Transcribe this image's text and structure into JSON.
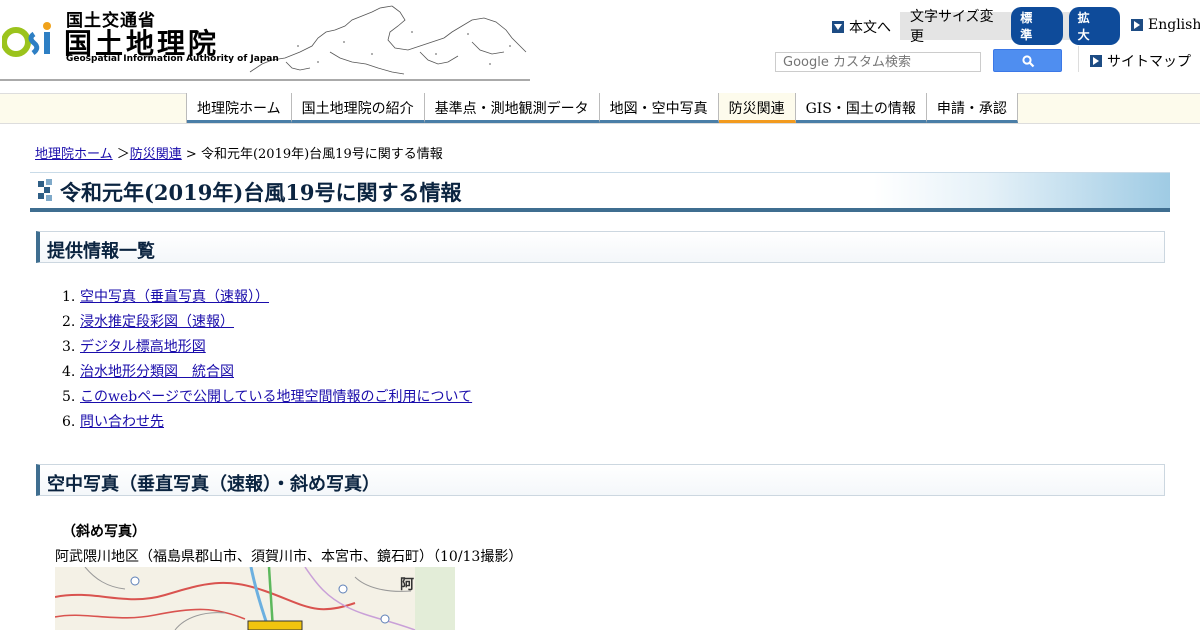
{
  "header": {
    "ministry": "国土交通省",
    "org_name": "国土地理院",
    "org_name_en": "Geospatial Information Authority of Japan",
    "skip_link": "本文へ",
    "font_size_label": "文字サイズ変更",
    "font_size_standard": "標 準",
    "font_size_large": "拡 大",
    "english_link": "English",
    "search_placeholder": "Google カスタム検索",
    "sitemap_link": "サイトマップ"
  },
  "nav": {
    "items": [
      {
        "label": "地理院ホーム"
      },
      {
        "label": "国土地理院の紹介"
      },
      {
        "label": "基準点・測地観測データ"
      },
      {
        "label": "地図・空中写真"
      },
      {
        "label": "防災関連"
      },
      {
        "label": "GIS・国土の情報"
      },
      {
        "label": "申請・承認"
      }
    ],
    "active_index": 4
  },
  "breadcrumb": {
    "home": "地理院ホーム",
    "sep1": " ＞",
    "disaster": "防災関連",
    "sep2": " > ",
    "current": "令和元年(2019年)台風19号に関する情報"
  },
  "page_title": "令和元年(2019年)台風19号に関する情報",
  "section1": {
    "heading": "提供情報一覧",
    "items": [
      {
        "num": "1.",
        "label": "空中写真（垂直写真（速報））"
      },
      {
        "num": "2.",
        "label": "浸水推定段彩図（速報）"
      },
      {
        "num": "3.",
        "label": "デジタル標高地形図"
      },
      {
        "num": "4.",
        "label": "治水地形分類図　統合図"
      },
      {
        "num": "5.",
        "label": "このwebページで公開している地理空間情報のご利用について"
      },
      {
        "num": "6.",
        "label": "問い合わせ先"
      }
    ]
  },
  "section2": {
    "heading": "空中写真（垂直写真（速報）・斜め写真）",
    "subheading": "（斜め写真）",
    "area": "阿武隈川地区（福島県郡山市、須賀川市、本宮市、鏡石町）（10/13撮影）",
    "map_label": "阿"
  },
  "colors": {
    "nav_underline": "#4a7ea7",
    "nav_active": "#f29a1e",
    "title_navy": "#0b2440",
    "link": "#1a0dab",
    "search_button": "#4f8ef0"
  }
}
